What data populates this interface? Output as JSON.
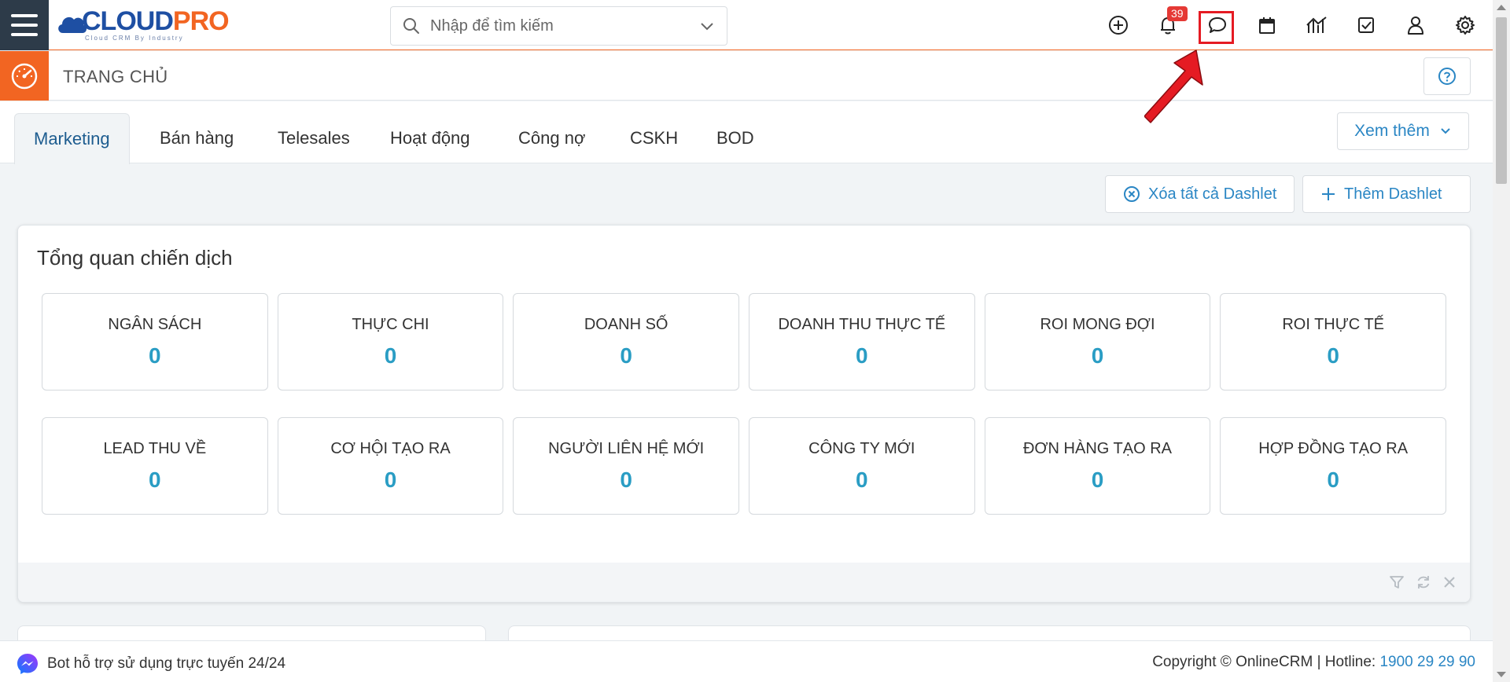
{
  "header": {
    "logo_main_1": "CLOUD",
    "logo_main_2": "PRO",
    "logo_sub": "Cloud CRM By Industry",
    "search_placeholder": "Nhập để tìm kiếm",
    "notification_count": "39",
    "icons": [
      "plus-circle-icon",
      "bell-icon",
      "chat-icon",
      "calendar-icon",
      "chart-icon",
      "checkbox-icon",
      "user-icon",
      "gear-icon"
    ]
  },
  "breadcrumb": {
    "title": "TRANG CHỦ"
  },
  "tabs": [
    {
      "label": "Marketing",
      "active": true
    },
    {
      "label": "Bán hàng"
    },
    {
      "label": "Telesales"
    },
    {
      "label": "Hoạt động"
    },
    {
      "label": "Công nợ"
    },
    {
      "label": "CSKH"
    },
    {
      "label": "BOD"
    }
  ],
  "more_label": "Xem thêm",
  "actions": {
    "clear_all": "Xóa tất cả Dashlet",
    "add": "Thêm Dashlet"
  },
  "dashlet": {
    "title": "Tổng quan chiến dịch",
    "cards": [
      {
        "label": "NGÂN SÁCH",
        "value": "0"
      },
      {
        "label": "THỰC CHI",
        "value": "0"
      },
      {
        "label": "DOANH SỐ",
        "value": "0"
      },
      {
        "label": "DOANH THU THỰC TẾ",
        "value": "0"
      },
      {
        "label": "ROI MONG ĐỢI",
        "value": "0"
      },
      {
        "label": "ROI THỰC TẾ",
        "value": "0"
      },
      {
        "label": "LEAD THU VỀ",
        "value": "0"
      },
      {
        "label": "CƠ HỘI TẠO RA",
        "value": "0"
      },
      {
        "label": "NGƯỜI LIÊN HỆ MỚI",
        "value": "0"
      },
      {
        "label": "CÔNG TY MỚI",
        "value": "0"
      },
      {
        "label": "ĐƠN HÀNG TẠO RA",
        "value": "0"
      },
      {
        "label": "HỢP ĐỒNG TẠO RA",
        "value": "0"
      }
    ]
  },
  "footer": {
    "bot_text": "Bot hỗ trợ sử dụng trực tuyến 24/24",
    "copyright": "Copyright © OnlineCRM",
    "hotline_label": "Hotline:",
    "hotline_number": "1900 29 29 90"
  },
  "colors": {
    "accent_orange": "#f26522",
    "dark_nav": "#2d3b49",
    "link_blue": "#2a86c4",
    "value_blue": "#2a9dc4",
    "badge_red": "#e53935"
  }
}
